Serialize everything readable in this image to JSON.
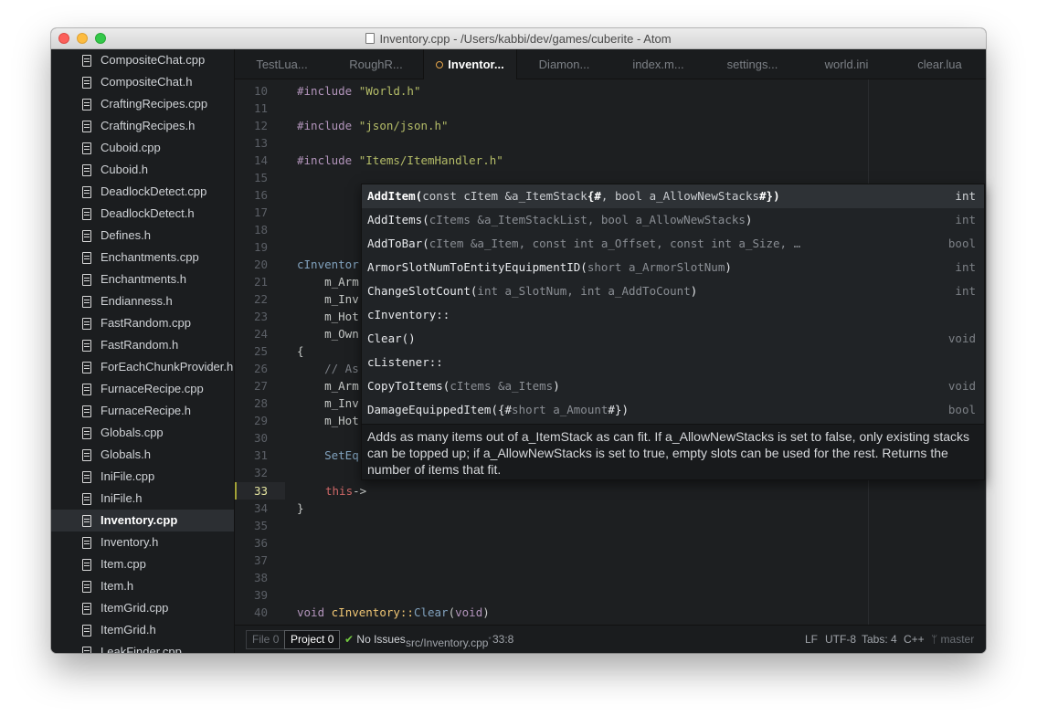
{
  "window": {
    "title": "Inventory.cpp - /Users/kabbi/dev/games/cuberite - Atom"
  },
  "sidebar": {
    "items": [
      {
        "label": "CompositeChat.cpp"
      },
      {
        "label": "CompositeChat.h"
      },
      {
        "label": "CraftingRecipes.cpp"
      },
      {
        "label": "CraftingRecipes.h"
      },
      {
        "label": "Cuboid.cpp"
      },
      {
        "label": "Cuboid.h"
      },
      {
        "label": "DeadlockDetect.cpp"
      },
      {
        "label": "DeadlockDetect.h"
      },
      {
        "label": "Defines.h"
      },
      {
        "label": "Enchantments.cpp"
      },
      {
        "label": "Enchantments.h"
      },
      {
        "label": "Endianness.h"
      },
      {
        "label": "FastRandom.cpp"
      },
      {
        "label": "FastRandom.h"
      },
      {
        "label": "ForEachChunkProvider.h"
      },
      {
        "label": "FurnaceRecipe.cpp"
      },
      {
        "label": "FurnaceRecipe.h"
      },
      {
        "label": "Globals.cpp"
      },
      {
        "label": "Globals.h"
      },
      {
        "label": "IniFile.cpp"
      },
      {
        "label": "IniFile.h"
      },
      {
        "label": "Inventory.cpp",
        "selected": true
      },
      {
        "label": "Inventory.h"
      },
      {
        "label": "Item.cpp"
      },
      {
        "label": "Item.h"
      },
      {
        "label": "ItemGrid.cpp"
      },
      {
        "label": "ItemGrid.h"
      },
      {
        "label": "LeakFinder.cpp"
      }
    ]
  },
  "tabs": [
    {
      "label": "TestLua..."
    },
    {
      "label": "RoughR..."
    },
    {
      "label": "Inventor...",
      "active": true,
      "modified": true
    },
    {
      "label": "Diamon..."
    },
    {
      "label": "index.m..."
    },
    {
      "label": "settings..."
    },
    {
      "label": "world.ini"
    },
    {
      "label": "clear.lua"
    }
  ],
  "editor": {
    "line_numbers": [
      "10",
      "11",
      "12",
      "13",
      "14",
      "15",
      "16",
      "17",
      "18",
      "19",
      "20",
      "21",
      "22",
      "23",
      "24",
      "25",
      "26",
      "27",
      "28",
      "29",
      "30",
      "31",
      "32",
      "33",
      "34",
      "35",
      "36",
      "37",
      "38",
      "39",
      "40"
    ],
    "current_line": "33",
    "lines": {
      "l10_kw": "#include",
      "l10_str": "\"World.h\"",
      "l12_kw": "#include",
      "l12_str": "\"json/json.h\"",
      "l14_kw": "#include",
      "l14_str": "\"Items/ItemHandler.h\"",
      "l20": "cInventor",
      "l21": "    m_Arm",
      "l22": "    m_Inv",
      "l23": "    m_Hot",
      "l24": "    m_Own",
      "l25": "{",
      "l26": "    // As",
      "l27": "    m_Arm",
      "l28": "    m_Inv",
      "l29": "    m_Hot",
      "l31": "    SetEq",
      "l33_this": "this",
      "l33_arrow": "->",
      "l34": "}",
      "l40_kw": "void",
      "l40_cls": "cInventory::",
      "l40_fn": "Clear",
      "l40_p1": "(",
      "l40_kw2": "void",
      "l40_p2": ")"
    }
  },
  "autocomplete": {
    "items": [
      {
        "name": "AddItem(",
        "params": "const cItem &a_ItemStack",
        "ph1": "{#",
        "mid": ", bool a_AllowNewStacks",
        "ph2": "#}",
        "close": ")",
        "type": "int",
        "selected": true
      },
      {
        "name": "AddItems(",
        "params": "cItems &a_ItemStackList, bool a_AllowNewStacks",
        "close": ")",
        "type": "int"
      },
      {
        "name": "AddToBar(",
        "params": "cItem &a_Item, const int a_Offset, const int a_Size, …",
        "close": "",
        "type": "bool"
      },
      {
        "name": "ArmorSlotNumToEntityEquipmentID(",
        "params": "short a_ArmorSlotNum",
        "close": ")",
        "type": "int"
      },
      {
        "name": "ChangeSlotCount(",
        "params": "int a_SlotNum, int a_AddToCount",
        "close": ")",
        "type": "int"
      },
      {
        "name": "cInventory::",
        "params": "",
        "close": "",
        "type": ""
      },
      {
        "name": "Clear()",
        "params": "",
        "close": "",
        "type": "void"
      },
      {
        "name": "cListener::",
        "params": "",
        "close": "",
        "type": ""
      },
      {
        "name": "CopyToItems(",
        "params": "cItems &a_Items",
        "close": ")",
        "type": "void"
      },
      {
        "name": "DamageEquippedItem({#",
        "params": "short a_Amount",
        "close": "#})",
        "type": "bool"
      }
    ],
    "description": "Adds as many items out of a_ItemStack as can fit. If a_AllowNewStacks is set to false, only existing stacks can be topped up; if a_AllowNewStacks is set to true, empty slots can be used for the rest. Returns the number of items that fit."
  },
  "statusbar": {
    "file_label": "File",
    "file_count": "0",
    "project_label": "Project",
    "project_count": "0",
    "issues": "No Issues",
    "path": "src/Inventory.cpp",
    "path_mark": "*",
    "cursor": "33:8",
    "line_ending": "LF",
    "encoding": "UTF-8",
    "tabs": "Tabs: 4",
    "grammar": "C++",
    "branch": "master"
  },
  "colors": {
    "accent_modified": "#e5a54a",
    "check": "#73c940",
    "keyword": "#b294bb",
    "string": "#b5bd68",
    "function": "#81a2be",
    "this": "#cc6666"
  }
}
